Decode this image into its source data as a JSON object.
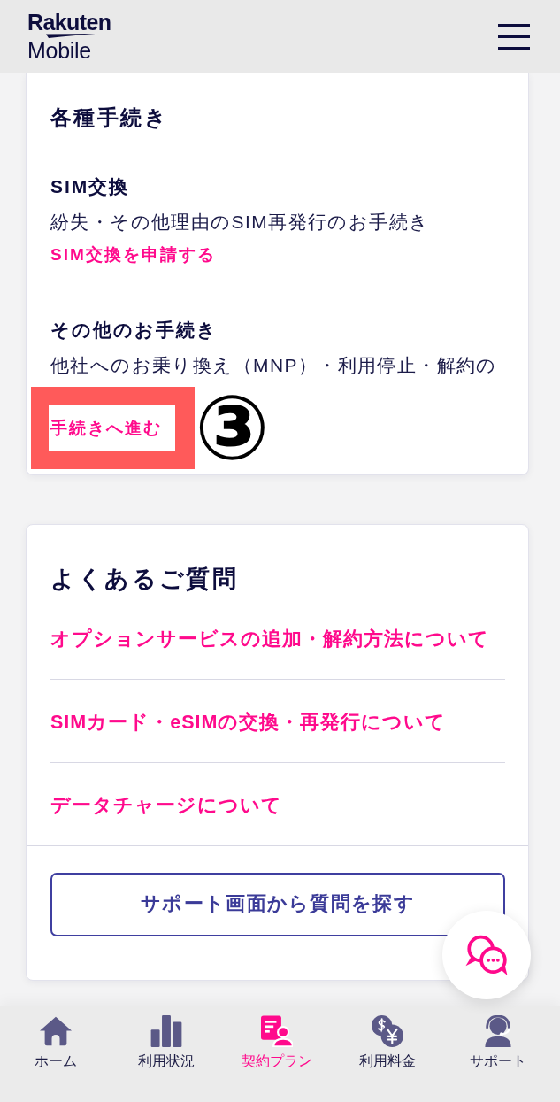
{
  "header": {
    "logo": {
      "wordmark": "Rakuten",
      "subtitle": "Mobile"
    }
  },
  "procedures": {
    "title": "各種手続き",
    "sections": [
      {
        "title": "SIM交換",
        "description": "紛失・その他理由のSIM再発行のお手続き",
        "link": "SIM交換を申請する"
      },
      {
        "title": "その他のお手続き",
        "description": "他社へのお乗り換え（MNP）・利用停止・解約の",
        "link": "手続きへ進む",
        "annotation": {
          "marker": "③"
        }
      }
    ]
  },
  "faq": {
    "title": "よくあるご質問",
    "links": [
      "オプションサービスの追加・解約方法について",
      "SIMカード・eSIMの交換・再発行について",
      "データチャージについて"
    ],
    "button": "サポート画面から質問を探す"
  },
  "bottom_nav": {
    "items": [
      {
        "kind": "home",
        "label": "ホーム",
        "selected": false
      },
      {
        "kind": "usage",
        "label": "利用状況",
        "selected": false
      },
      {
        "kind": "plan",
        "label": "契約プラン",
        "selected": true
      },
      {
        "kind": "billing",
        "label": "利用料金",
        "selected": false
      },
      {
        "kind": "support",
        "label": "サポート",
        "selected": false
      }
    ]
  }
}
